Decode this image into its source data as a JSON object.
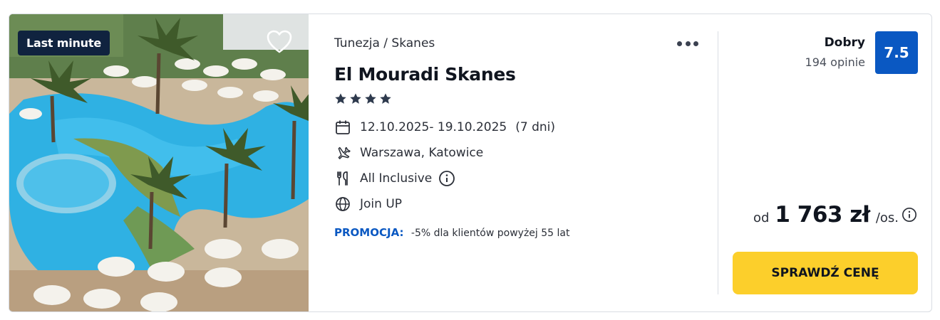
{
  "offer": {
    "badge": "Last minute",
    "breadcrumb": "Tunezja / Skanes",
    "hotel_name": "El Mouradi Skanes",
    "stars": 4,
    "dates": "12.10.2025- 19.10.2025",
    "duration": "(7 dni)",
    "departure": "Warszawa, Katowice",
    "board": "All Inclusive",
    "tour_operator": "Join UP",
    "promo_label": "PROMOCJA:",
    "promo_text": "-5% dla klientów powyżej 55 lat"
  },
  "rating": {
    "label": "Dobry",
    "count": "194 opinie",
    "score": "7.5"
  },
  "price": {
    "from": "od",
    "amount": "1 763 zł",
    "per": "/os."
  },
  "cta_label": "SPRAWDŹ CENĘ",
  "icons": {
    "favorite": "heart-icon",
    "more": "more-dots-icon",
    "star": "star-icon",
    "date": "calendar-icon",
    "departure": "plane-icon",
    "board": "cutlery-icon",
    "info": "info-icon",
    "operator": "globe-icon"
  },
  "colors": {
    "badge_bg": "#10233f",
    "accent_blue": "#0a58c2",
    "cta_yellow": "#fccf2b"
  }
}
